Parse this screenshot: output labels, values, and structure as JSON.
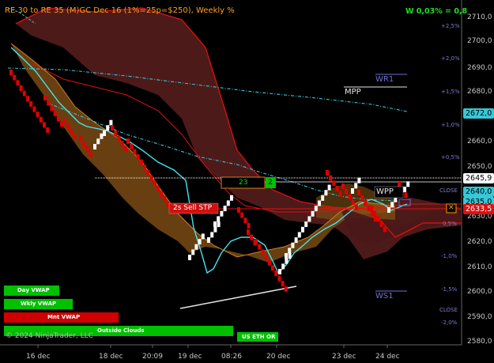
{
  "header": {
    "title": "RE 30 to RE 35 (M)GC Dec 16 (1%=25p=$250), Weekly %",
    "stat": "W 0,03% = 0,8"
  },
  "price_axis": [
    "2710,0",
    "2700,0",
    "2690,0",
    "2680,0",
    "2660,0",
    "2650,0",
    "2630,0",
    "2620,0",
    "2610,0",
    "2600,0",
    "2590,0",
    "2580,0"
  ],
  "pct_labels": [
    "+2,5%",
    "+2,0%",
    "+1,5%",
    "+1,0%",
    "+0,5%",
    "0,5%",
    "-1,0%",
    "-1,5%",
    "-2,0%"
  ],
  "pct_close_labels": [
    "CLOSE",
    "CLOSE"
  ],
  "price_tags": {
    "mpp_price": "2672,0",
    "last_price": "2645,9",
    "mid_price": "2640,0",
    "support_price": "2635,0",
    "sell_price": "2633,5"
  },
  "levels": {
    "wr1": "WR1",
    "mpp": "MPP",
    "wpp": "WPP",
    "ws1": "WS1"
  },
  "boxes": {
    "counter": "23",
    "counter2": "2",
    "signal": "2s  Sell STP",
    "close_marker": "✕"
  },
  "status_bars": {
    "day_vwap": "Day VWAP",
    "wkly_vwap": "Wkly VWAP",
    "mnt_vwap": "Mnt VWAP",
    "outside_clouds": "Outside Clouds",
    "us_eth_or": "US ETH OR"
  },
  "copyright": "© 2024 NinjaTrader, LLC",
  "x_axis": [
    "16 dec",
    "18 dec",
    "20:09",
    "19 dec",
    "08:26",
    "20 dec",
    "23 dec",
    "24 dec"
  ],
  "colors": {
    "up_brick": "#ffffff",
    "down_brick": "#e00000",
    "cloud_dark": "#5a1e1e",
    "cloud_orange": "#8a5a16",
    "cyan": "#36d6e0",
    "red_line": "#e01010",
    "green": "#00c000"
  }
}
